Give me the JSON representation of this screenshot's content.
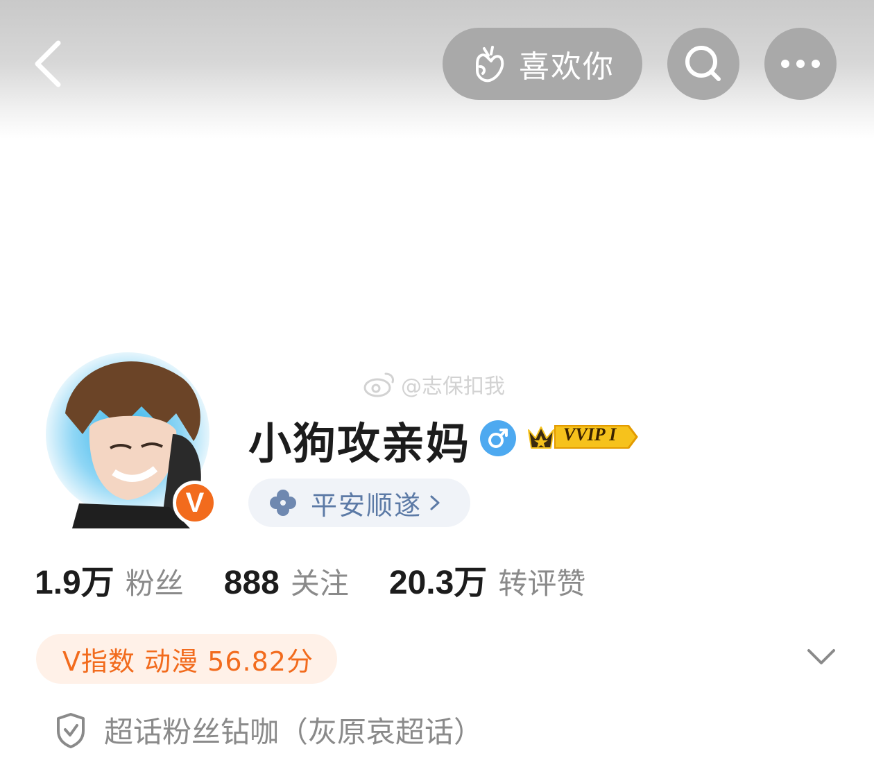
{
  "header": {
    "like_button_label": "喜欢你",
    "icons": {
      "back": "back-chevron-icon",
      "like": "finger-heart-icon",
      "search": "search-icon",
      "more": "more-dots-icon"
    }
  },
  "watermark": {
    "text": "@志保扣我",
    "icon": "weibo-logo-icon"
  },
  "profile": {
    "username": "小狗攻亲妈",
    "gender_icon": "male-icon",
    "vip_label": "VVIP I",
    "avatar_verified_badge": "V",
    "status": {
      "label": "平安顺遂",
      "icon": "clover-icon"
    }
  },
  "stats": [
    {
      "number": "1.9",
      "unit": "万",
      "label": "粉丝"
    },
    {
      "number": "888",
      "unit": "",
      "label": "关注"
    },
    {
      "number": "20.3",
      "unit": "万",
      "label": "转评赞"
    }
  ],
  "v_index": {
    "text": "V指数 动漫 56.82分"
  },
  "super_topic": {
    "text": "超话粉丝钻咖（灰原哀超话）",
    "icon": "shield-check-icon"
  },
  "colors": {
    "accent_orange": "#f26b1d",
    "status_blue": "#5c7aa6",
    "gender_blue": "#4da9f0",
    "vip_gold": "#f6c21c"
  }
}
